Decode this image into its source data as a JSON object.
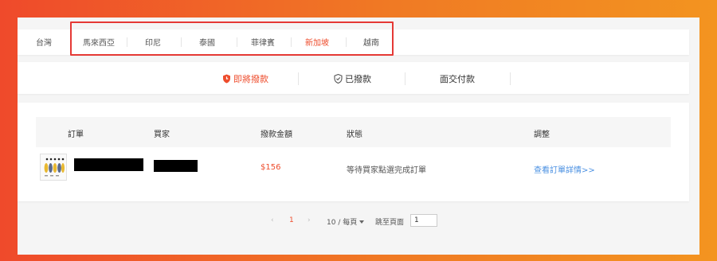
{
  "regions": {
    "tabs": [
      "台灣",
      "馬來西亞",
      "印尼",
      "泰國",
      "菲律賓",
      "新加坡",
      "越南"
    ],
    "active": "新加坡"
  },
  "payment_tabs": {
    "upcoming": "即將撥款",
    "paid": "已撥款",
    "cod": "面交付款"
  },
  "table": {
    "headers": [
      "訂單",
      "買家",
      "撥款金額",
      "狀態",
      "調整"
    ],
    "rows": [
      {
        "amount": "$156",
        "status": "等待買家點選完成訂單",
        "action": "查看訂單詳情>>"
      }
    ]
  },
  "pagination": {
    "prev": "‹",
    "current": "1",
    "next": "›",
    "per_page": "10 / 每頁",
    "goto_label": "跳至頁面",
    "goto_value": "1"
  },
  "colors": {
    "accent": "#ee4d2d",
    "link": "#4a90e2",
    "highlight": "#e53935"
  }
}
